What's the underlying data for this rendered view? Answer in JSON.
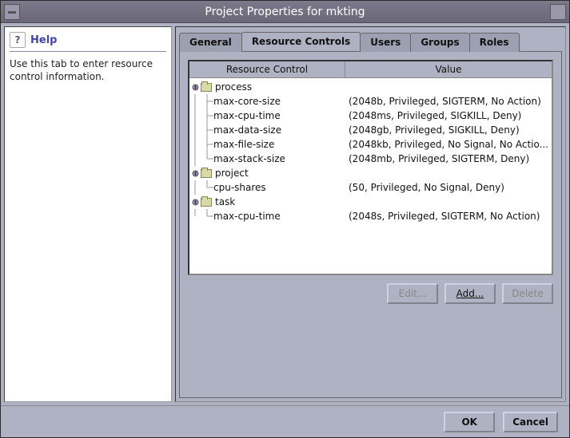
{
  "window": {
    "title": "Project Properties for mkting"
  },
  "help": {
    "title": "Help",
    "icon_glyph": "?",
    "text": "Use this tab to enter resource control information."
  },
  "tabs": [
    {
      "label": "General",
      "active": false
    },
    {
      "label": "Resource Controls",
      "active": true
    },
    {
      "label": "Users",
      "active": false
    },
    {
      "label": "Groups",
      "active": false
    },
    {
      "label": "Roles",
      "active": false
    }
  ],
  "table": {
    "headers": {
      "rc": "Resource Control",
      "val": "Value"
    },
    "groups": [
      {
        "name": "process",
        "items": [
          {
            "name": "max-core-size",
            "value": "(2048b, Privileged, SIGTERM, No Action)"
          },
          {
            "name": "max-cpu-time",
            "value": "(2048ms, Privileged, SIGKILL, Deny)"
          },
          {
            "name": "max-data-size",
            "value": "(2048gb, Privileged, SIGKILL, Deny)"
          },
          {
            "name": "max-file-size",
            "value": "(2048kb, Privileged, No Signal, No Actio..."
          },
          {
            "name": "max-stack-size",
            "value": "(2048mb, Privileged, SIGTERM, Deny)"
          }
        ]
      },
      {
        "name": "project",
        "items": [
          {
            "name": "cpu-shares",
            "value": "(50, Privileged, No Signal, Deny)"
          }
        ]
      },
      {
        "name": "task",
        "items": [
          {
            "name": "max-cpu-time",
            "value": "(2048s, Privileged, SIGTERM, No Action)"
          }
        ]
      }
    ]
  },
  "actions": {
    "edit": "Edit...",
    "add": "Add...",
    "delete": "Delete"
  },
  "footer": {
    "ok": "OK",
    "cancel": "Cancel"
  }
}
